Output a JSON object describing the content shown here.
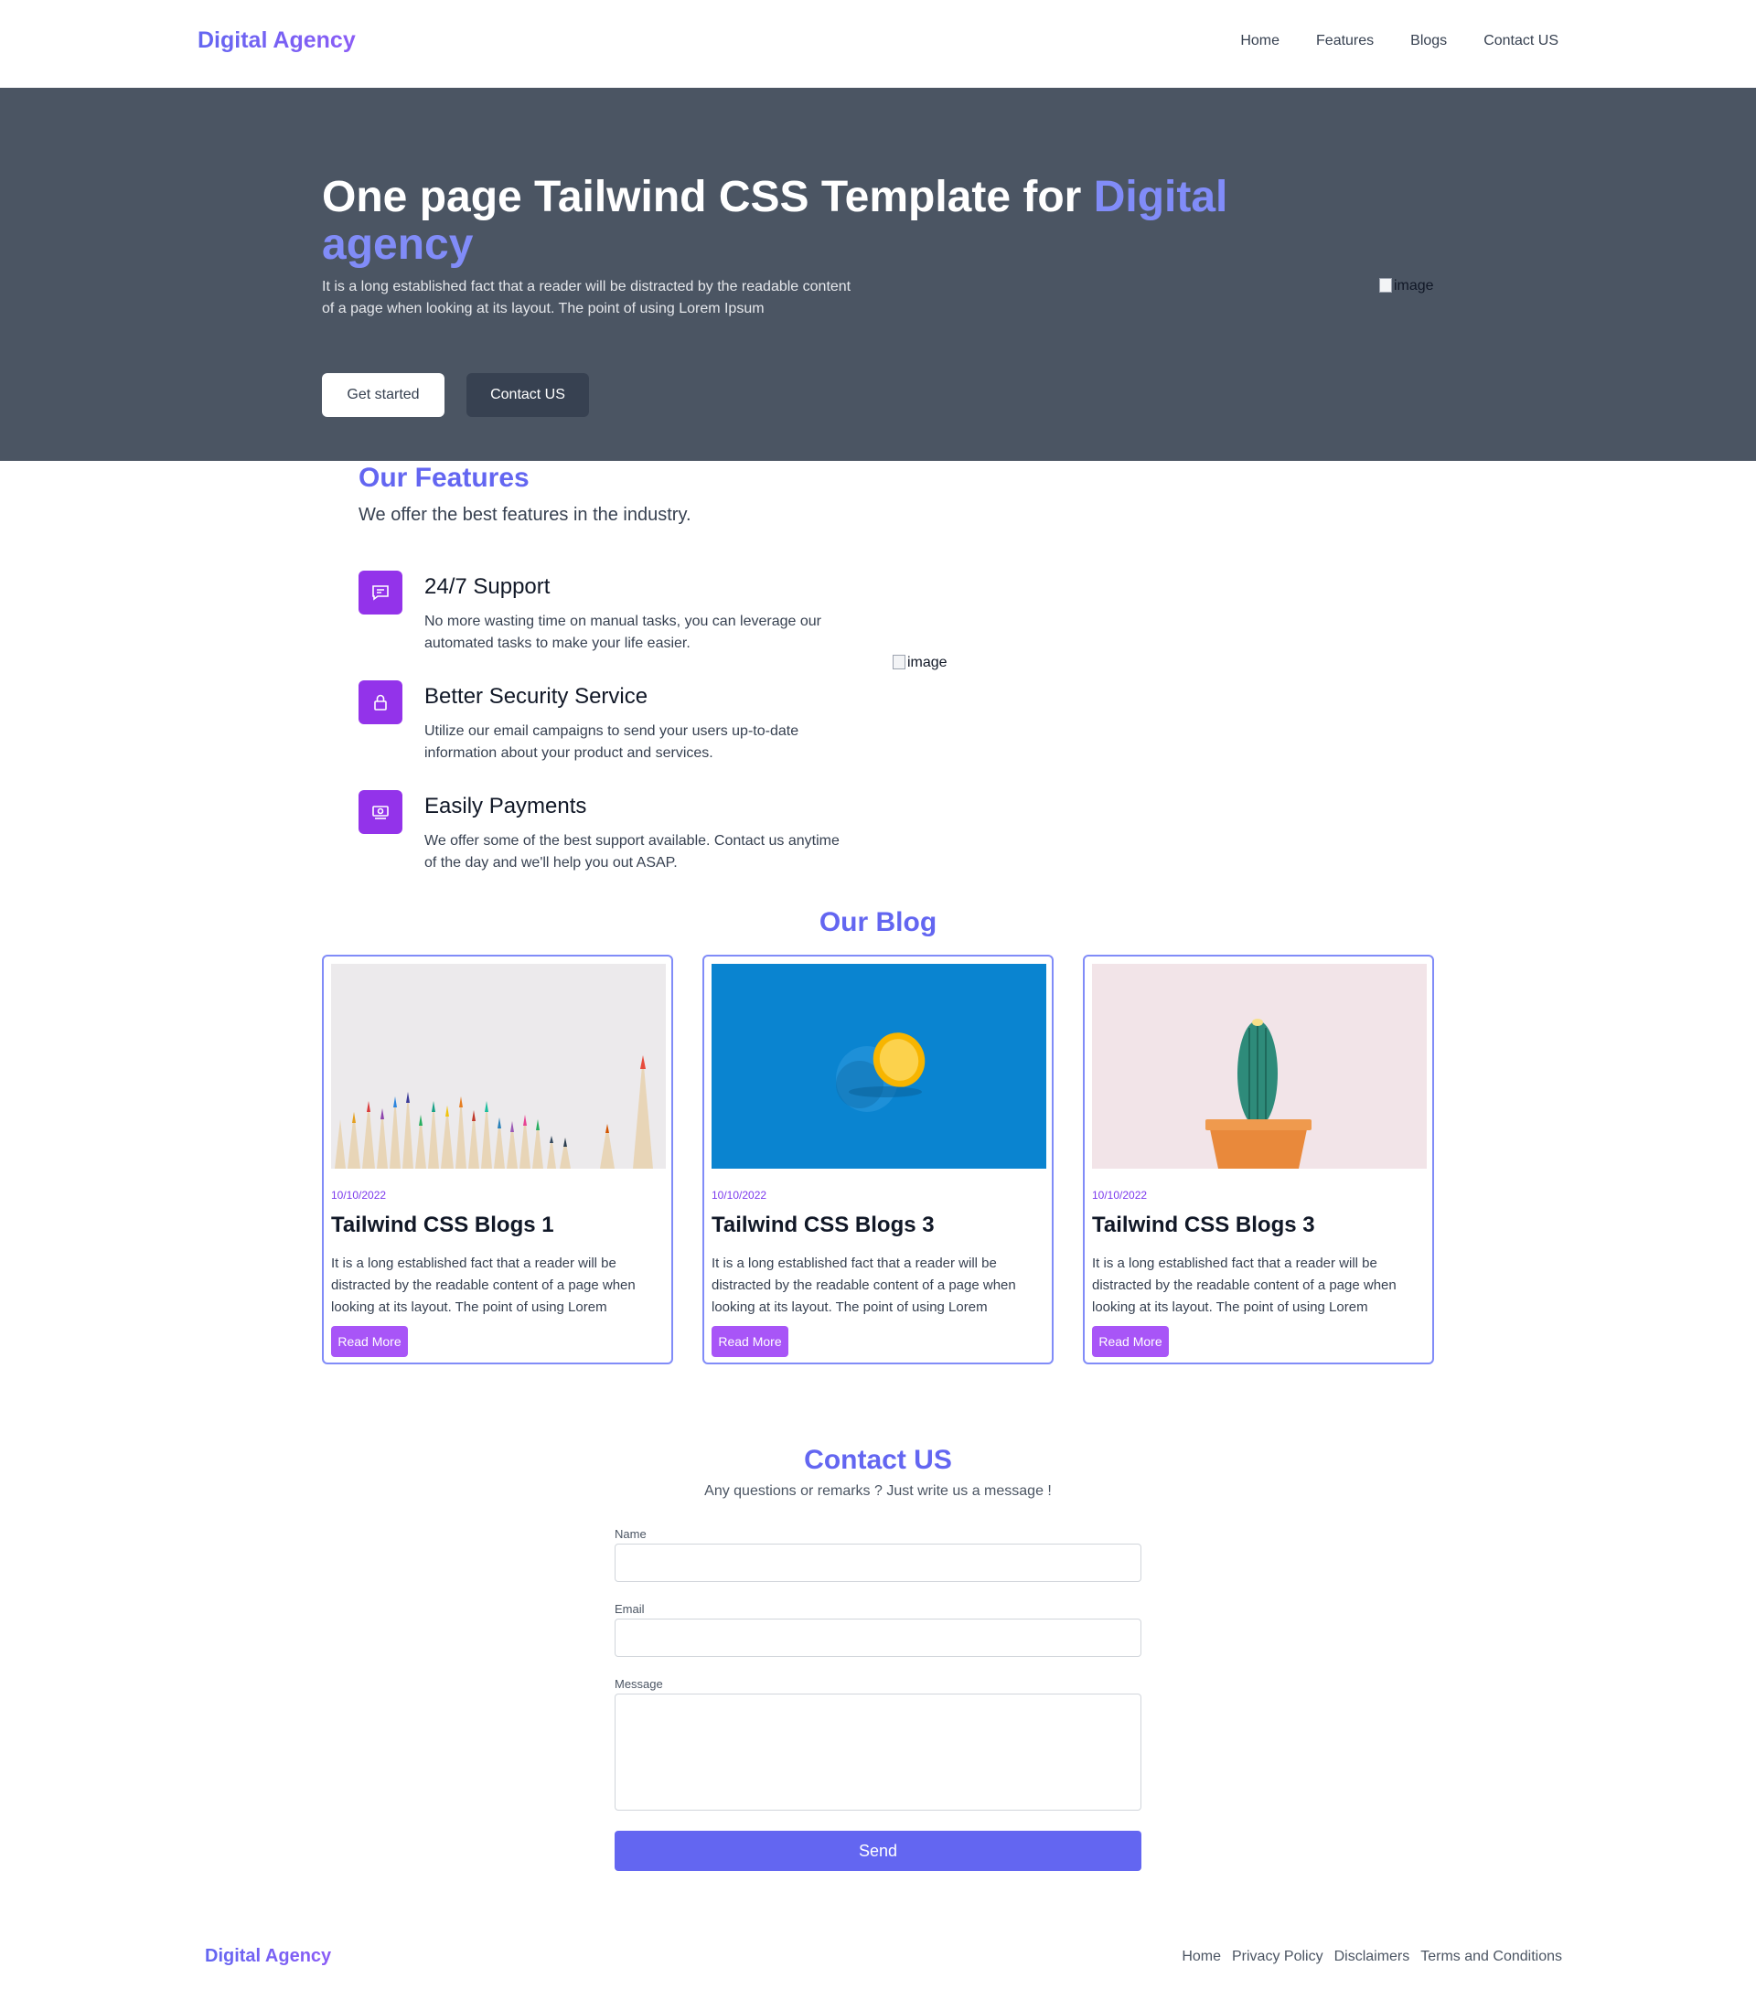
{
  "nav": {
    "brand": "Digital Agency",
    "links": [
      "Home",
      "Features",
      "Blogs",
      "Contact US"
    ]
  },
  "hero": {
    "title_main": "One page Tailwind CSS Template for ",
    "title_highlight": "Digital agency",
    "description": "It is a long established fact that a reader will be distracted by the readable content of a page when looking at its layout. The point of using Lorem Ipsum",
    "primary_button": "Get started",
    "secondary_button": "Contact US",
    "image_alt": "image"
  },
  "features": {
    "title": "Our Features",
    "subtitle": "We offer the best features in the industry.",
    "image_alt": "image",
    "items": [
      {
        "icon": "chat-icon",
        "title": "24/7 Support",
        "text": "No more wasting time on manual tasks, you can leverage our automated tasks to make your life easier."
      },
      {
        "icon": "lock-icon",
        "title": "Better Security Service",
        "text": "Utilize our email campaigns to send your users up-to-date information about your product and services."
      },
      {
        "icon": "payment-icon",
        "title": "Easily Payments",
        "text": "We offer some of the best support available. Contact us anytime of the day and we'll help you out ASAP."
      }
    ]
  },
  "blog": {
    "title": "Our Blog",
    "cards": [
      {
        "image": "colored-pencils-image",
        "date": "10/10/2022",
        "title": "Tailwind CSS Blogs 1",
        "text": "It is a long established fact that a reader will be distracted by the readable content of a page when looking at its layout. The point of using Lorem",
        "button": "Read More"
      },
      {
        "image": "blue-orange-image",
        "date": "10/10/2022",
        "title": "Tailwind CSS Blogs 3",
        "text": "It is a long established fact that a reader will be distracted by the readable content of a page when looking at its layout. The point of using Lorem",
        "button": "Read More"
      },
      {
        "image": "cactus-image",
        "date": "10/10/2022",
        "title": "Tailwind CSS Blogs 3",
        "text": "It is a long established fact that a reader will be distracted by the readable content of a page when looking at its layout. The point of using Lorem",
        "button": "Read More"
      }
    ]
  },
  "contact": {
    "title": "Contact US",
    "subtitle": "Any questions or remarks ? Just write us a message !",
    "name_label": "Name",
    "name_value": "",
    "email_label": "Email",
    "email_value": "",
    "message_label": "Message",
    "message_value": "",
    "send_button": "Send"
  },
  "footer": {
    "brand": "Digital Agency",
    "links": [
      "Home",
      "Privacy Policy",
      "Disclaimers",
      "Terms and Conditions"
    ]
  },
  "colors": {
    "accent": "#6366f1",
    "purple": "#9333ea",
    "hero_bg": "#4b5563"
  }
}
